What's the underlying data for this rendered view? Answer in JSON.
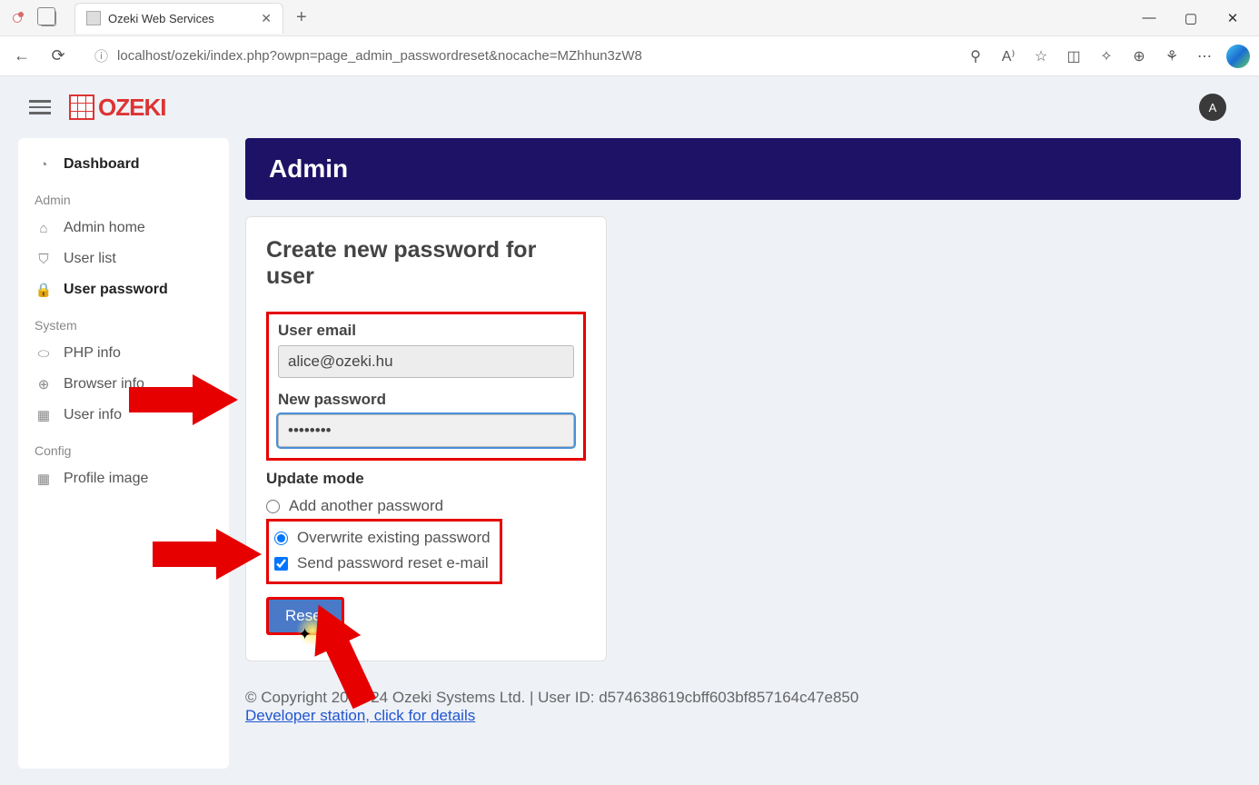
{
  "browser": {
    "tab_title": "Ozeki Web Services",
    "url": "localhost/ozeki/index.php?owpn=page_admin_passwordreset&nocache=MZhhun3zW8"
  },
  "header": {
    "logo_text": "OZEKI",
    "avatar_letter": "A"
  },
  "sidebar": {
    "dashboard": "Dashboard",
    "section_admin": "Admin",
    "admin_home": "Admin home",
    "user_list": "User list",
    "user_password": "User password",
    "section_system": "System",
    "php_info": "PHP info",
    "browser_info": "Browser info",
    "user_info": "User info",
    "section_config": "Config",
    "profile_image": "Profile image"
  },
  "main": {
    "title": "Admin",
    "card_title": "Create new password for user",
    "email_label": "User email",
    "email_value": "alice@ozeki.hu",
    "password_label": "New password",
    "password_value": "••••••••",
    "mode_label": "Update mode",
    "mode_add": "Add another password",
    "mode_overwrite": "Overwrite existing password",
    "mode_send": "Send password reset e-mail",
    "reset_label": "Reset"
  },
  "footer": {
    "copyright": "© Copyright 2000-24 Ozeki Systems Ltd. | User ID: d574638619cbff603bf857164c47e850",
    "link": "Developer station, click for details"
  }
}
